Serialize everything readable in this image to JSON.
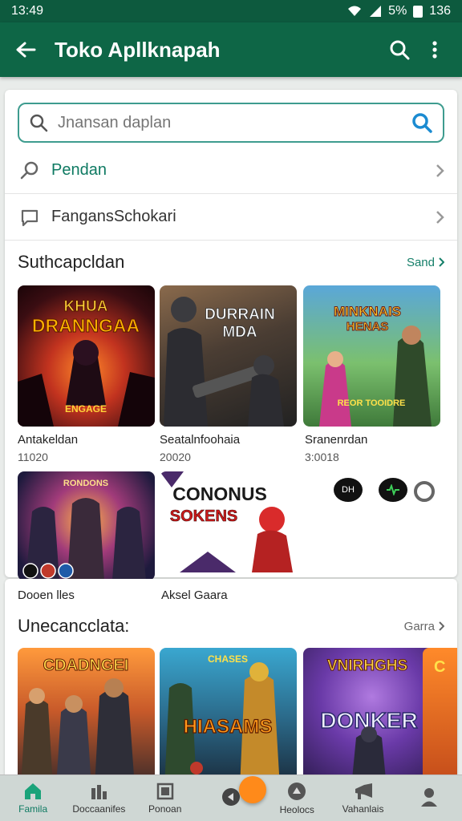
{
  "status": {
    "time": "13:49",
    "battery": "5%",
    "right_time": "136"
  },
  "app_bar": {
    "title": "Toko Apllknapah"
  },
  "search": {
    "placeholder": "Jnansan daplan"
  },
  "rows": [
    {
      "label": "Pendan",
      "icon": "search-icon"
    },
    {
      "label": "FangansSchokari",
      "icon": "chat-icon"
    }
  ],
  "section1": {
    "title": "Suthcapcldan",
    "see_more": "Sand",
    "tiles": [
      {
        "art_text": "KHUA DRANNGAA",
        "art_sub": "ENGAGE",
        "name": "Antakeldan",
        "sub": "11020"
      },
      {
        "art_text": "DURRAIN MDA",
        "name": "Seatalnfoohaia",
        "sub": "20020"
      },
      {
        "art_text": "MINKNAIS HENAS",
        "art_sub": "REOR TOOIDRE",
        "name": "Sranenrdan",
        "sub": "3:0018"
      },
      {
        "art_text": "RONDONS",
        "name": "Dooen lles"
      },
      {
        "art_text": "CONONUS SOKENS",
        "name": "Aksel Gaara"
      }
    ],
    "chips": [
      "DH",
      "",
      ""
    ]
  },
  "section2": {
    "title": "Unecancclata:",
    "see_more": "Garra",
    "tiles": [
      {
        "art_text": "CDADNGEI"
      },
      {
        "art_text": "HIASAMS"
      },
      {
        "art_text": "VNIRHGHS",
        "art_sub": "DONKER"
      },
      {
        "art_text": "C"
      }
    ]
  },
  "bottom_nav": [
    {
      "label": "Famila",
      "icon": "home-icon",
      "active": true
    },
    {
      "label": "Doccaanifes",
      "icon": "chart-icon",
      "active": false
    },
    {
      "label": "Ponoan",
      "icon": "box-icon",
      "active": false
    },
    {
      "label": "",
      "icon": "play-icon",
      "active": false
    },
    {
      "label": "Heolocs",
      "icon": "compass-icon",
      "active": false
    },
    {
      "label": "Vahanlais",
      "icon": "megaphone-icon",
      "active": false
    },
    {
      "label": "",
      "icon": "person-icon",
      "active": false
    }
  ],
  "colors": {
    "primary": "#0e6646",
    "status_bar": "#0d5a3e",
    "accent": "#157f69",
    "nav_bg": "#cfd7d4"
  }
}
